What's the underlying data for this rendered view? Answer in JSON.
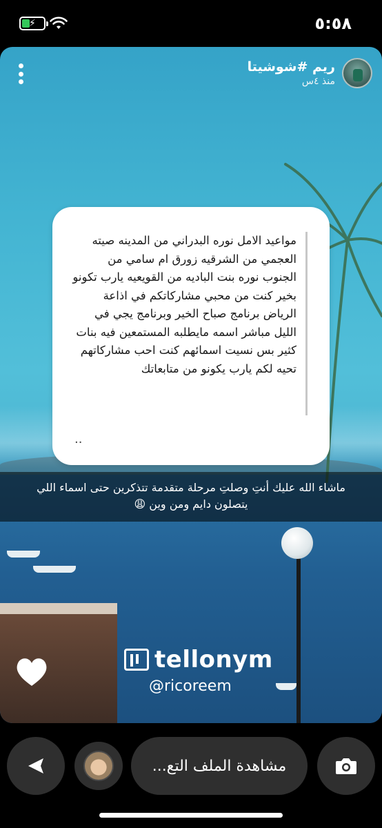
{
  "status_bar": {
    "time": "٥:٥٨",
    "battery_level": 0.35
  },
  "story": {
    "username": "ريم #شوشيتا",
    "time_ago": "منذ ٤س",
    "question": "مواعيد الامل نوره البدراني من المدينه صيته العجمي من الشرقيه زورق ام سامي من الجنوب نوره بنت الباديه من القويعيه يارب تكونو بخير كنت من محبي مشاركاتكم في اذاعة الرياض برنامج صباح الخير وبرنامج يجي في الليل مباشر اسمه مايطلبه المستمعين فيه بنات كثير بس نسيت اسمائهم كنت احب مشاركاتهم تحيه لكم يارب يكونو من متابعاتك",
    "question_ellipsis": "..",
    "reply_caption_line1": "ماشاء الله عليك أنتِ وصلتِ مرحلة متقدمة تتذكرين حتى اسماء اللي",
    "reply_caption_line2": "يتصلون دايم ومن وين 😩",
    "watermark_brand": "tellonym",
    "watermark_handle": "@ricoreem"
  },
  "bottom_bar": {
    "view_profile_label": "مشاهدة الملف التع..."
  },
  "icons": {
    "send": "send-arrow-icon",
    "heart": "heart-icon",
    "camera": "camera-icon",
    "more": "more-vertical-icon",
    "wifi": "wifi-icon",
    "battery": "battery-charging-icon"
  },
  "colors": {
    "battery_green": "#34c759",
    "button_bg": "#2f2f2f",
    "card_bg": "#ffffff"
  }
}
